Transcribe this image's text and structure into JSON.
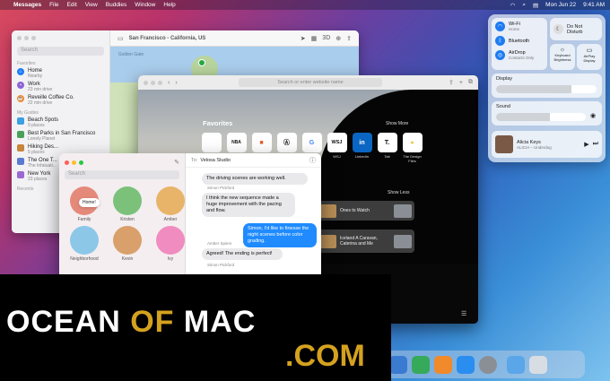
{
  "menubar": {
    "app": "Messages",
    "items": [
      "File",
      "Edit",
      "View",
      "Buddies",
      "Window",
      "Help"
    ],
    "date": "Mon Jun 22",
    "time": "9:41 AM"
  },
  "maps": {
    "search_placeholder": "Search",
    "location": "San Francisco - California, US",
    "map_label": "Golden Gate",
    "favorites_header": "Favorites",
    "favorites": [
      {
        "title": "Home",
        "sub": "Nearby"
      },
      {
        "title": "Work",
        "sub": "23 min drive"
      },
      {
        "title": "Reveille Coffee Co.",
        "sub": "22 min drive"
      }
    ],
    "guides_header": "My Guides",
    "guides": [
      {
        "title": "Beach Spots",
        "sub": "9 places"
      },
      {
        "title": "Best Parks in San Francisco",
        "sub": "Lonely Planet"
      },
      {
        "title": "Hiking Des...",
        "sub": "5 places"
      },
      {
        "title": "The One T...",
        "sub": "The Infatuati..."
      },
      {
        "title": "New York",
        "sub": "23 places"
      }
    ],
    "recents_header": "Recents"
  },
  "safari": {
    "address_placeholder": "Search or enter website name",
    "favorites_title": "Favorites",
    "show_more": "Show More",
    "favorites": [
      {
        "glyph": "",
        "label": "Apple"
      },
      {
        "glyph": "NBA",
        "label": ""
      },
      {
        "glyph": "■",
        "label": ""
      },
      {
        "glyph": "Ⓐ",
        "label": ""
      },
      {
        "glyph": "G",
        "label": ""
      },
      {
        "glyph": "WSJ",
        "label": "WSJ"
      },
      {
        "glyph": "in",
        "label": "LinkedIn"
      },
      {
        "glyph": "T.",
        "label": "Tait"
      },
      {
        "glyph": "●",
        "label": "The Design Files"
      }
    ],
    "show_less": "Show Less",
    "reading": [
      {
        "title": "Ones to Watch"
      },
      {
        "title": "Iceland A Caravan, Caterina and Me"
      }
    ]
  },
  "messages": {
    "search_placeholder": "Search",
    "pins": [
      {
        "name": "Family",
        "color": "#e58a7a"
      },
      {
        "name": "Kristen",
        "color": "#7bc17a"
      },
      {
        "name": "Amber",
        "color": "#e8b46a"
      },
      {
        "name": "Neighborhood",
        "color": "#8cc7e8"
      },
      {
        "name": "Kevin",
        "color": "#d9a06b"
      },
      {
        "name": "Ivy",
        "color": "#f08cc0"
      }
    ],
    "home_bubble": "Home!",
    "to_label": "To:",
    "to_name": "Velosa Studio",
    "conversation": [
      {
        "from": "",
        "text": "The driving scenes are working well.",
        "dir": "in"
      },
      {
        "from": "Simon Pickford",
        "text": "I think the new sequence made a huge improvement with the pacing and flow.",
        "dir": "in"
      },
      {
        "from": "",
        "text": "Simon, I'd like to finesse the night scenes before color grading.",
        "dir": "out"
      },
      {
        "from": "Amber Spiers",
        "text": "Agreed! The ending is perfect!",
        "dir": "in"
      },
      {
        "from": "Simon Pickford",
        "text": "",
        "dir": "in"
      }
    ]
  },
  "control_center": {
    "wifi": {
      "title": "Wi-Fi",
      "sub": "Home"
    },
    "bluetooth": {
      "title": "Bluetooth",
      "sub": ""
    },
    "airdrop": {
      "title": "AirDrop",
      "sub": "Contacts Only"
    },
    "dnd": {
      "title": "Do Not Disturb"
    },
    "keyboard": "Keyboard Brightness",
    "airplay": "AirPlay Display",
    "display_label": "Display",
    "display_level": 0.75,
    "sound_label": "Sound",
    "sound_level": 0.6,
    "now_playing": {
      "title": "Alicia Keys",
      "sub": "ALICIA – Underdog"
    }
  },
  "watermark": {
    "line1a": "OCEAN ",
    "line1b": "OF",
    "line1c": " MAC",
    "line2": ".COM"
  }
}
